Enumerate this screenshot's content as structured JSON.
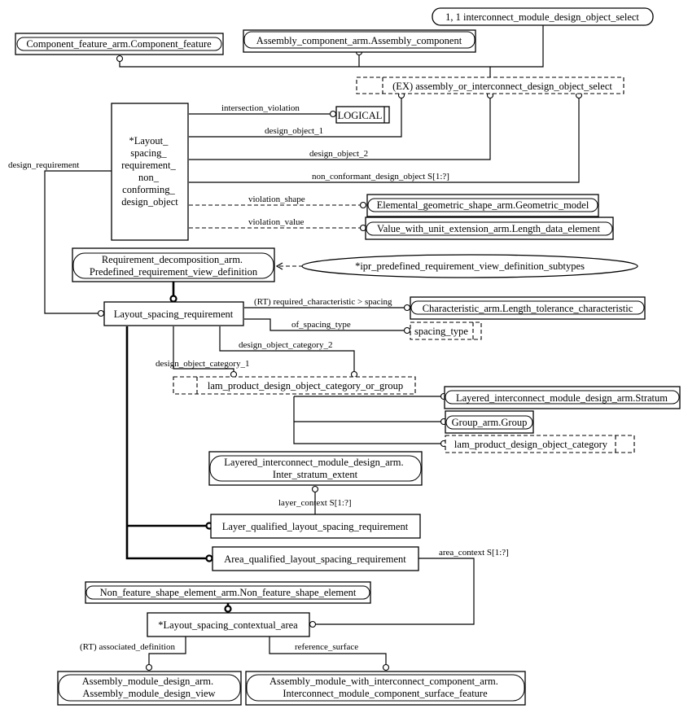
{
  "diagram": {
    "type": "EXPRESS-G schema diagram",
    "entities": {
      "component_feature": "Component_feature_arm.Component_feature",
      "assembly_component": "Assembly_component_arm.Assembly_component",
      "interconnect_select": "1, 1 interconnect_module_design_object_select",
      "assembly_or_interconnect_select": "(EX) assembly_or_interconnect_design_object_select",
      "logical": "LOGICAL",
      "non_conforming_lines": [
        "*Layout_",
        "spacing_",
        "requirement_",
        "non_",
        "conforming_",
        "design_object"
      ],
      "geometric_model": "Elemental_geometric_shape_arm.Geometric_model",
      "length_data_element": "Value_with_unit_extension_arm.Length_data_element",
      "predefined_view_lines": [
        "Requirement_decomposition_arm.",
        "Predefined_requirement_view_definition"
      ],
      "ipr_subtypes": "*ipr_predefined_requirement_view_definition_subtypes",
      "layout_spacing_requirement": "Layout_spacing_requirement",
      "length_tolerance": "Characteristic_arm.Length_tolerance_characteristic",
      "spacing_type": "spacing_type",
      "category_or_group": "lam_product_design_object_category_or_group",
      "stratum": "Layered_interconnect_module_design_arm.Stratum",
      "group": "Group_arm.Group",
      "category": "lam_product_design_object_category",
      "inter_stratum_lines": [
        "Layered_interconnect_module_design_arm.",
        "Inter_stratum_extent"
      ],
      "layer_qualified": "Layer_qualified_layout_spacing_requirement",
      "area_qualified": "Area_qualified_layout_spacing_requirement",
      "non_feature_shape": "Non_feature_shape_element_arm.Non_feature_shape_element",
      "contextual_area": "*Layout_spacing_contextual_area",
      "assembly_view_lines": [
        "Assembly_module_design_arm.",
        "Assembly_module_design_view"
      ],
      "surface_feature_lines": [
        "Assembly_module_with_interconnect_component_arm.",
        "Interconnect_module_component_surface_feature"
      ]
    },
    "relations": {
      "intersection_violation": "intersection_violation",
      "design_object_1": "design_object_1",
      "design_object_2": "design_object_2",
      "non_conformant_design_object": "non_conformant_design_object S[1:?]",
      "violation_shape": "violation_shape",
      "violation_value": "violation_value",
      "design_requirement": "design_requirement",
      "required_characteristic": "(RT) required_characteristic > spacing",
      "of_spacing_type": "of_spacing_type",
      "design_object_category_2": "design_object_category_2",
      "design_object_category_1": "design_object_category_1",
      "layer_context": "layer_context S[1:?]",
      "area_context": "area_context S[1:?]",
      "associated_definition": "(RT) associated_definition",
      "reference_surface": "reference_surface"
    }
  }
}
